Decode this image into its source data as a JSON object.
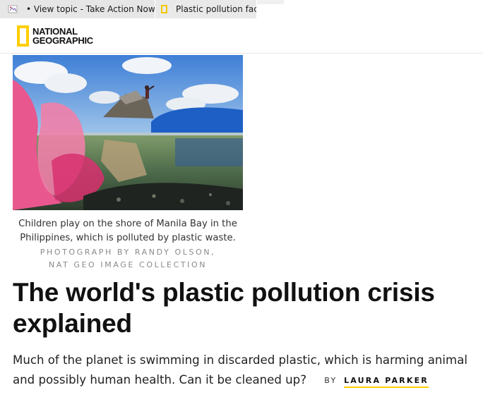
{
  "browser": {
    "tabs": [
      {
        "title": "• View topic - Take Action Now!",
        "icon": "forum-favicon-icon"
      },
      {
        "title": "Plastic pollution facts",
        "icon": "natgeo-favicon-icon"
      }
    ]
  },
  "header": {
    "logo_line1": "NATIONAL",
    "logo_line2": "GEOGRAPHIC",
    "brand_color": "#ffce00"
  },
  "article": {
    "image_caption": "Children play on the shore of Manila Bay in the Philippines, which is polluted by plastic waste.",
    "photo_credit_line1": "PHOTOGRAPH BY RANDY OLSON,",
    "photo_credit_line2": "NAT GEO IMAGE COLLECTION",
    "headline": "The world's plastic pollution crisis explained",
    "dek": "Much of the planet is swimming in discarded plastic, which is harming animal and possibly human health. Can it be cleaned up?",
    "byline_prefix": "BY",
    "author": "LAURA PARKER"
  }
}
